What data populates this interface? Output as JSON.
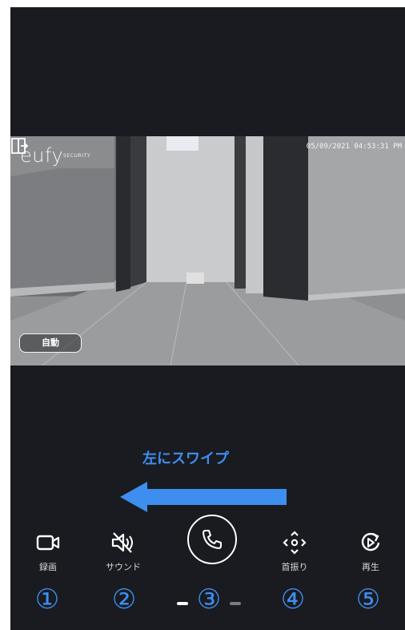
{
  "feed": {
    "brand": "eufy",
    "brand_sub": "SECURITY",
    "timestamp": "05/09/2021 04:53:31 PM",
    "mode_button": "自動"
  },
  "instruction": {
    "text": "左にスワイプ",
    "color": "#3e8ef0"
  },
  "controls": [
    {
      "label": "録画",
      "icon": "video-camera-icon"
    },
    {
      "label": "サウンド",
      "icon": "speaker-muted-icon"
    },
    {
      "label": "",
      "icon": "phone-call-icon"
    },
    {
      "label": "首振り",
      "icon": "pan-tilt-icon"
    },
    {
      "label": "再生",
      "icon": "replay-icon"
    }
  ],
  "markers": [
    "①",
    "②",
    "③",
    "④",
    "⑤"
  ],
  "colors": {
    "accent": "#3e8ef0",
    "background": "#191b20"
  }
}
